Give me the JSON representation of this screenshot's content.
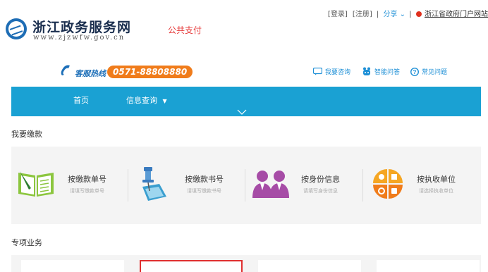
{
  "header": {
    "site_name": "浙江政务服务网",
    "site_url": "www.zjzwfw.gov.cn",
    "page_tag": "公共支付",
    "top_links": {
      "login": "[登录]",
      "register": "[注册]",
      "share": "分享",
      "portal": "浙江省政府门户网站"
    }
  },
  "hotline": {
    "label": "客服热线",
    "number": "0571-88808880",
    "services": [
      {
        "label": "我要咨询",
        "icon": "chat-icon"
      },
      {
        "label": "智能问答",
        "icon": "robot-icon"
      },
      {
        "label": "常见问题",
        "icon": "question-icon"
      }
    ]
  },
  "nav": {
    "items": [
      {
        "label": "首页"
      },
      {
        "label": "信息查询"
      }
    ],
    "caret_icon": "chevron-down-icon"
  },
  "payment": {
    "title": "我要缴款",
    "items": [
      {
        "title": "按缴款单号",
        "subtitle": "请填写缴款单号",
        "icon": "notebook-icon"
      },
      {
        "title": "按缴款书号",
        "subtitle": "请填写缴款书号",
        "icon": "pushpin-document-icon"
      },
      {
        "title": "按身份信息",
        "subtitle": "请填写身份信息",
        "icon": "people-icon"
      },
      {
        "title": "按执收单位",
        "subtitle": "请选择执收单位",
        "icon": "quadrant-icon"
      }
    ]
  },
  "special": {
    "title": "专项业务"
  },
  "colors": {
    "nav": "#1aa1d3",
    "hotline_badge": "#f07c1b",
    "page_tag": "#e63c3c",
    "link_blue": "#1d8fd6",
    "highlight": "#e03030"
  }
}
